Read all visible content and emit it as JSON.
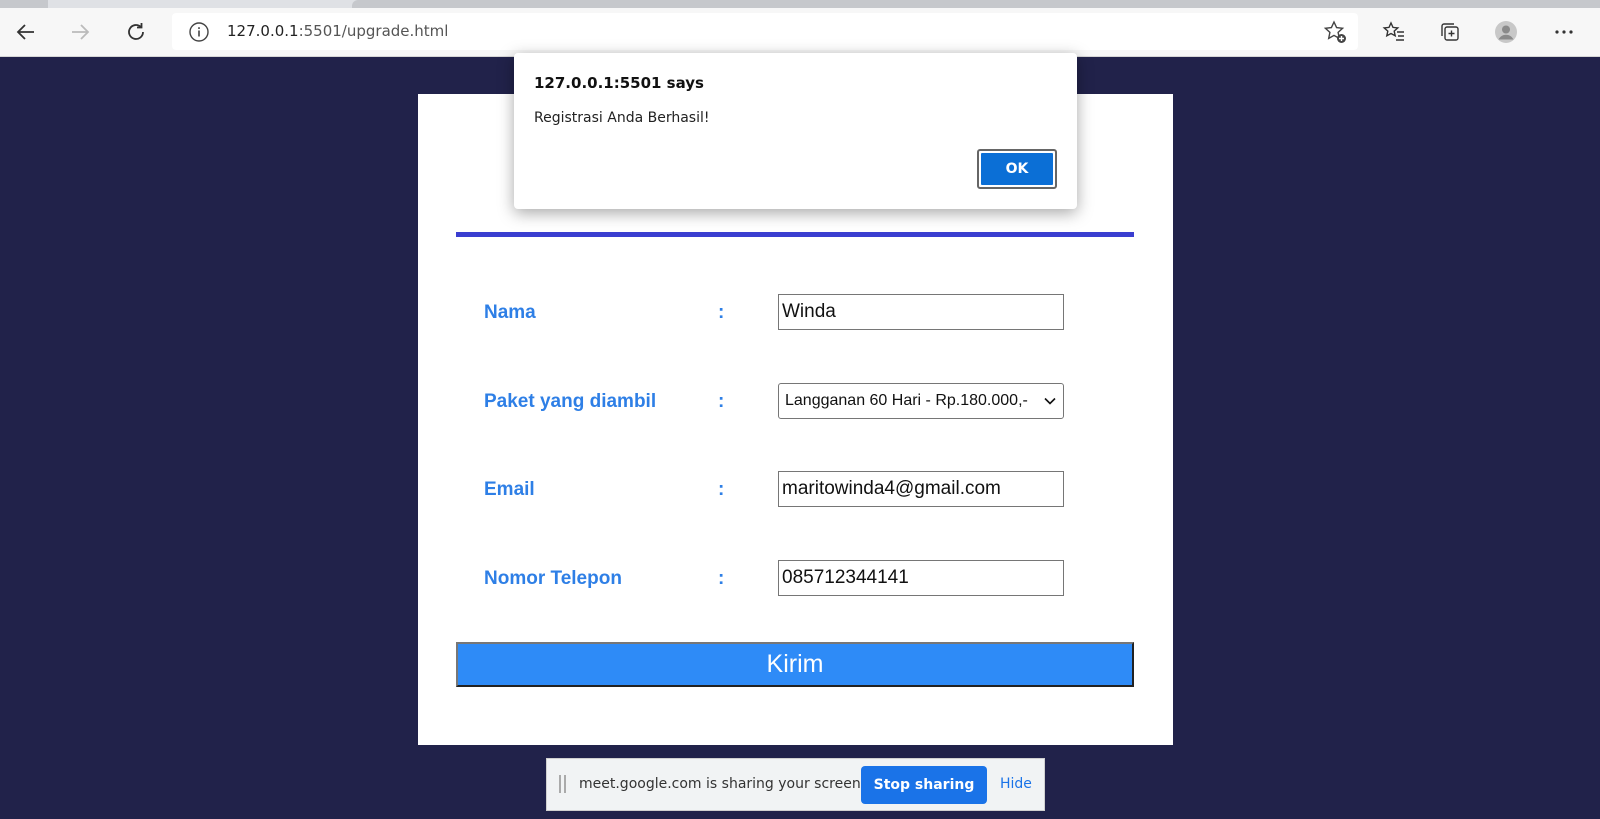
{
  "browser": {
    "url_host": "127.0.0.1",
    "url_rest": ":5501/upgrade.html"
  },
  "form": {
    "rows": [
      {
        "label": "Nama",
        "colon": ":",
        "value": "Winda"
      },
      {
        "label": "Paket yang diambil",
        "colon": ":",
        "value": "Langganan 60 Hari - Rp.180.000,-"
      },
      {
        "label": "Email",
        "colon": ":",
        "value": "maritowinda4@gmail.com"
      },
      {
        "label": "Nomor Telepon",
        "colon": ":",
        "value": "085712344141"
      }
    ],
    "submit_label": "Kirim"
  },
  "dialog": {
    "title": "127.0.0.1:5501 says",
    "message": "Registrasi Anda Berhasil!",
    "ok_label": "OK"
  },
  "share_bar": {
    "text": "meet.google.com is sharing your screen.",
    "stop_label": "Stop sharing",
    "hide_label": "Hide"
  },
  "colors": {
    "page_background": "#21224a",
    "label_blue": "#2e7fe6",
    "divider": "#3a3ed0",
    "submit_button": "#2e8bf7",
    "dialog_ok": "#0b6fd6",
    "share_stop": "#1a73e8"
  }
}
